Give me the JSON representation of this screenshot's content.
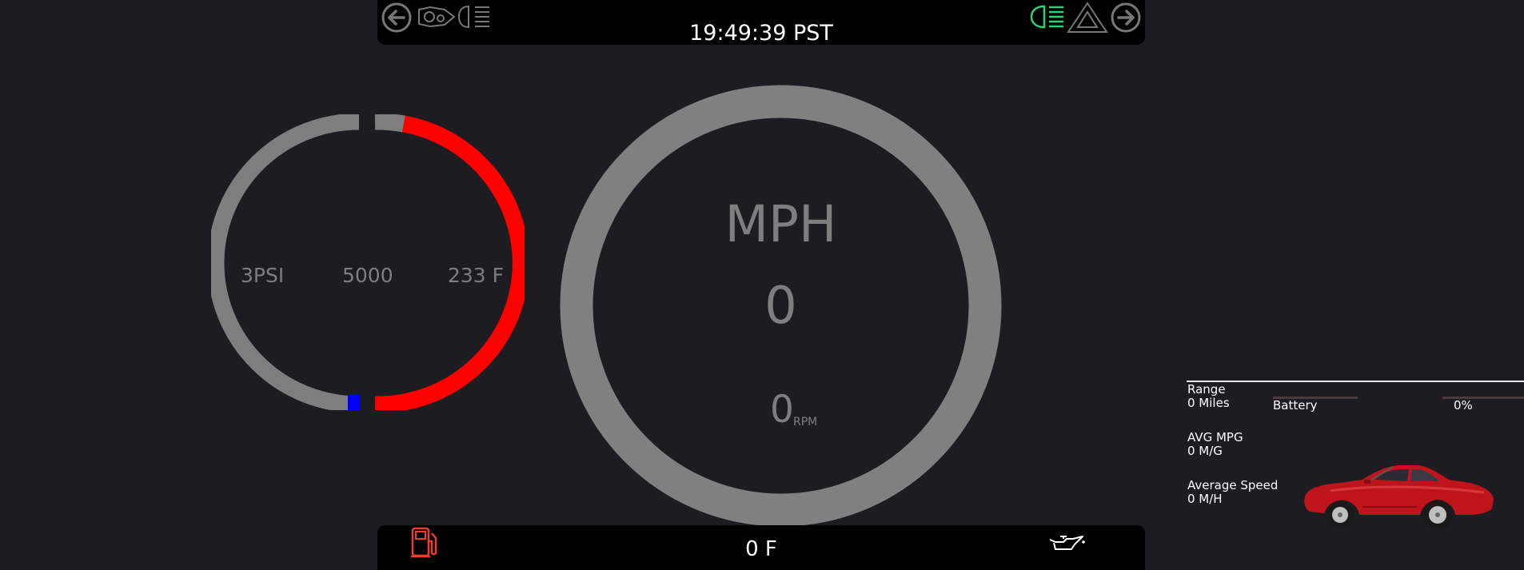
{
  "topbar": {
    "time": "19:49:39 PST",
    "icons": [
      "left-arrow-icon",
      "parking-light-icon",
      "low-beam-icon",
      "high-beam-icon",
      "hazard-icon",
      "right-arrow-icon"
    ],
    "high_beam_color": "#2bd07a"
  },
  "left_gauge": {
    "boost": "3PSI",
    "rpm": "5000",
    "coolant_temp": "233 F",
    "colors": {
      "track": "#7e7e7e",
      "active": "#ff0000",
      "marker": "#0000ff"
    }
  },
  "speedometer": {
    "unit": "MPH",
    "speed": "0",
    "rpm": "0",
    "rpm_unit": "RPM",
    "ring_color": "#808080"
  },
  "bottombar": {
    "outside_temp": "0 F",
    "fuel_icon_color": "#e8402c",
    "oil_icon_color": "#ffffff"
  },
  "info": {
    "range_label": "Range",
    "range_value": "0 Miles",
    "battery_label": "Battery",
    "battery_pct": "0%",
    "mpg_label": "AVG MPG",
    "mpg_value": "0 M/G",
    "speed_label": "Average Speed",
    "speed_value": "0 M/H",
    "car_color": "#c0141c"
  }
}
